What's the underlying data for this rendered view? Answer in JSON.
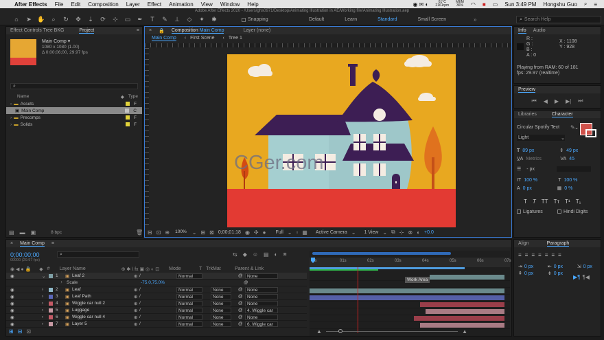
{
  "menubar": {
    "apple_icon": "apple-icon",
    "app_name": "After Effects",
    "items": [
      "File",
      "Edit",
      "Composition",
      "Layer",
      "Effect",
      "Animation",
      "View",
      "Window",
      "Help"
    ],
    "battery": "61°C",
    "battery2": "2161rpm",
    "mem_label": "MEM",
    "mem_value": "36%",
    "clock": "Sun 3:49 PM",
    "user": "Hongshu Guo"
  },
  "title": "Adobe After Effects 2020 - /Users/ghs0971/Desktop/Animating Illustration in AE/Working file/Animating Illustration.aep",
  "toolbar": {
    "snapping": "Snapping",
    "workspaces": [
      "Default",
      "Learn",
      "Standard",
      "Small Screen"
    ],
    "active_workspace": "Standard",
    "search_placeholder": "Search Help"
  },
  "effect_controls_tab": "Effect Controls Tree BKG",
  "project": {
    "tab": "Project",
    "comp_name": "Main Comp ▾",
    "comp_size": "1080 x 1080 (1.00)",
    "comp_duration": "Δ 0;00;06;00, 29.97 fps",
    "search_placeholder": "",
    "col_name": "Name",
    "col_type": "Type",
    "items": [
      {
        "name": "Assets",
        "type": "F",
        "color": "#e2d33b",
        "selected": false
      },
      {
        "name": "Main Comp",
        "type": "C",
        "color": "#c4c4c4",
        "selected": true
      },
      {
        "name": "Precomps",
        "type": "F",
        "color": "#e2d33b",
        "selected": false
      },
      {
        "name": "Solids",
        "type": "F",
        "color": "#e2d33b",
        "selected": false
      }
    ],
    "bpc": "8 bpc"
  },
  "composition": {
    "tab_prefix": "Composition",
    "tab_name": "Main Comp",
    "layer_tab": "Layer (none)",
    "breadcrumbs": [
      "Main Comp",
      "First Scene",
      "Tree 1"
    ],
    "zoom": "100%",
    "timecode": "0;00;01;18",
    "resolution": "Full",
    "camera": "Active Camera",
    "views": "1 View",
    "exposure": "+0.0"
  },
  "watermark": "CGer.com",
  "info": {
    "tab": "Info",
    "audio_tab": "Audio",
    "r": "R :",
    "g": "G :",
    "b": "B :",
    "a": "A : 0",
    "x": "X : 1108",
    "y": "Y : 928",
    "status1": "Playing from RAM: 60 of 181",
    "status2": "fps: 29.97 (realtime)"
  },
  "preview_tab": "Preview",
  "libraries_tab": "Libraries",
  "character": {
    "tab": "Character",
    "font": "Circular Spotify Text",
    "style": "Light",
    "size": "89 px",
    "leading": "49 px",
    "kerning": "Metrics",
    "tracking": "45",
    "stroke": "- px",
    "vscale": "100 %",
    "hscale": "100 %",
    "baseline": "0 px",
    "tsume": "0 %",
    "ligatures": "Ligatures",
    "hindi": "Hindi Digits",
    "fill_color": "#d0524b"
  },
  "align_tab": "Align",
  "paragraph": {
    "tab": "Paragraph",
    "indent1": "0 px",
    "indent2": "0 px",
    "indent3": "0 px",
    "space1": "0 px",
    "space2": "0 px"
  },
  "timeline": {
    "tab": "Main Comp",
    "timecode": "0;00;00;00",
    "frames": "00000 (29.97 fps)",
    "col_layer": "Layer Name",
    "col_mode": "Mode",
    "col_t": "T",
    "col_trkmat": "TrkMat",
    "col_parent": "Parent & Link",
    "ruler": [
      "0s",
      "01s",
      "02s",
      "03s",
      "04s",
      "05s",
      "06s",
      "07s"
    ],
    "work_area": "Work Area",
    "layers": [
      {
        "num": "1",
        "name": "Leaf 2",
        "color": "#7fa0a6",
        "mode": "Normal",
        "trkmat": "",
        "parent": "None",
        "bar": "#6a8a8c"
      },
      {
        "num": "",
        "name": "Scale",
        "color": "",
        "mode": "",
        "trkmat": "",
        "parent": "",
        "value": "-75.0,75.0%",
        "bar": ""
      },
      {
        "num": "2",
        "name": "Leaf",
        "color": "#8fb8c8",
        "mode": "Normal",
        "trkmat": "None",
        "parent": "None",
        "bar": "#6a8a8c"
      },
      {
        "num": "3",
        "name": "Leaf Path",
        "color": "#5b67b8",
        "mode": "Normal",
        "trkmat": "None",
        "parent": "None",
        "bar": "#5560a8"
      },
      {
        "num": "4",
        "name": "Wiggle car null 2",
        "color": "#c45a66",
        "mode": "Normal",
        "trkmat": "None",
        "parent": "None",
        "bar": "#9a3e4a"
      },
      {
        "num": "5",
        "name": "Luggage",
        "color": "#c89aa4",
        "mode": "Normal",
        "trkmat": "None",
        "parent": "4. Wiggle car",
        "bar": "#a97b84"
      },
      {
        "num": "6",
        "name": "Wiggle car null 4",
        "color": "#c45a66",
        "mode": "Normal",
        "trkmat": "None",
        "parent": "None",
        "bar": "#9a3e4a"
      },
      {
        "num": "7",
        "name": "Layer 5",
        "color": "#c89aa4",
        "mode": "Normal",
        "trkmat": "None",
        "parent": "6. Wiggle car",
        "bar": "#a97b84"
      }
    ]
  }
}
